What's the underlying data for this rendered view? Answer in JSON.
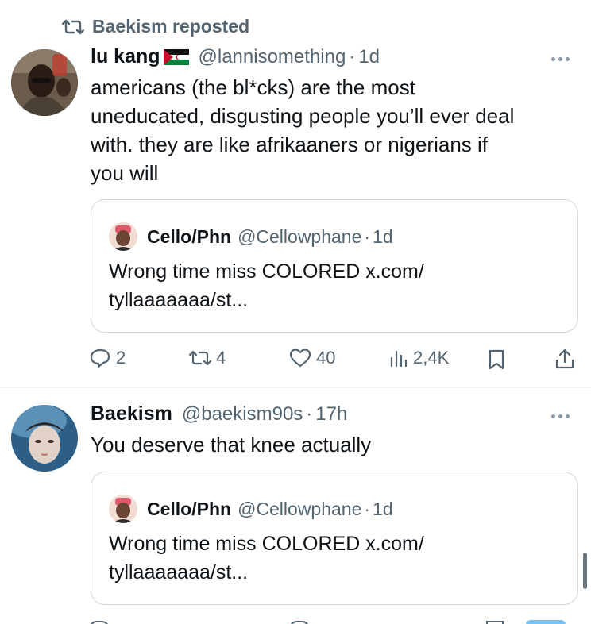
{
  "repost": {
    "text": "Baekism reposted"
  },
  "post1": {
    "name": "lu kang",
    "handle": "@lannisomething",
    "dot": "·",
    "time": "1d",
    "lines": [
      "americans (the bl*cks) are the most",
      "uneducated, disgusting people you’ll ever deal",
      "with.  they are like afrikaaners or nigerians if",
      "you will"
    ],
    "quote": {
      "name": "Cello/Phn",
      "handle": "@Cellowphane",
      "dot": "·",
      "time": "1d",
      "lines": [
        "Wrong time miss COLORED x.com/",
        "tyllaaaaaaa/st..."
      ]
    },
    "actions": {
      "replies": "2",
      "reposts": "4",
      "likes": "40",
      "views": "2,4K"
    }
  },
  "post2": {
    "name": "Baekism",
    "handle": "@baekism90s",
    "dot": "·",
    "time": "17h",
    "lines": [
      "You deserve that knee actually"
    ],
    "quote": {
      "name": "Cello/Phn",
      "handle": "@Cellowphane",
      "dot": "·",
      "time": "1d",
      "lines": [
        "Wrong time miss COLORED x.com/",
        "tyllaaaaaaa/st..."
      ]
    }
  },
  "colors": {
    "text": "#0f1419",
    "muted": "#536471",
    "border": "#cfd9de"
  }
}
